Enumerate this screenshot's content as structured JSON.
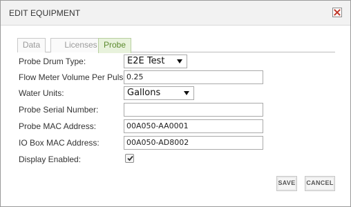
{
  "dialog": {
    "title": "EDIT EQUIPMENT",
    "close_icon": "close-icon"
  },
  "tabs": [
    {
      "label": "Data",
      "active": false
    },
    {
      "label": "Licenses",
      "active": false
    },
    {
      "label": "Probe",
      "active": true
    }
  ],
  "form": {
    "probe_drum_type": {
      "label": "Probe Drum Type:",
      "value": "E2E Test"
    },
    "flow_meter_volume": {
      "label": "Flow Meter Volume Per Pulse:",
      "value": "0.25"
    },
    "water_units": {
      "label": "Water Units:",
      "value": "Gallons"
    },
    "probe_serial": {
      "label": "Probe Serial Number:",
      "value": ""
    },
    "probe_mac": {
      "label": "Probe MAC Address:",
      "value": "00A050-AA0001"
    },
    "io_box_mac": {
      "label": "IO Box MAC Address:",
      "value": "00A050-AD8002"
    },
    "display_enabled": {
      "label": "Display Enabled:",
      "checked": true
    }
  },
  "buttons": {
    "save": "SAVE",
    "cancel": "CANCEL"
  },
  "colors": {
    "active_tab_bg": "#e8f2dc",
    "active_tab_text": "#5c8a2e",
    "close_x": "#c0392b"
  }
}
